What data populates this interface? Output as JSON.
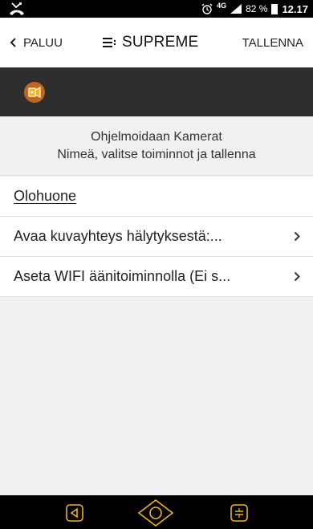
{
  "status_bar": {
    "missed_call_icon": "missed-call-icon",
    "alarm_icon": "alarm-icon",
    "network": "4G",
    "battery_percent": "82 %",
    "time": "12.17"
  },
  "header": {
    "back_label": "PALUU",
    "brand": "SUPREME",
    "save_label": "TALLENNA"
  },
  "instructions": {
    "line1": "Ohjelmoidaan Kamerat",
    "line2": "Nimeä, valitse toiminnot ja tallenna"
  },
  "camera_name": "Olohuone",
  "settings": [
    {
      "label": "Avaa kuvayhteys hälytyksestä:..."
    },
    {
      "label": "Aseta WIFI äänitoiminnolla (Ei s..."
    }
  ],
  "colors": {
    "accent": "#f6b21b",
    "toolbar": "#2e2e2e",
    "background": "#f1f1f1"
  }
}
